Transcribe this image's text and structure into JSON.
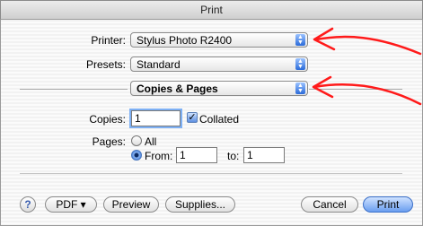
{
  "window": {
    "title": "Print"
  },
  "printer": {
    "label": "Printer:",
    "value": "Stylus Photo R2400"
  },
  "presets": {
    "label": "Presets:",
    "value": "Standard"
  },
  "section": {
    "value": "Copies & Pages"
  },
  "copies": {
    "label": "Copies:",
    "value": "1",
    "collated_label": "Collated",
    "collated_checked": true
  },
  "pages": {
    "label": "Pages:",
    "all_label": "All",
    "from_label": "From:",
    "from_value": "1",
    "to_label": "to:",
    "to_value": "1"
  },
  "buttons": {
    "help": "?",
    "pdf": "PDF ▾",
    "preview": "Preview",
    "supplies": "Supplies...",
    "cancel": "Cancel",
    "print": "Print"
  },
  "annotation": {
    "color": "#ff1a1a"
  }
}
